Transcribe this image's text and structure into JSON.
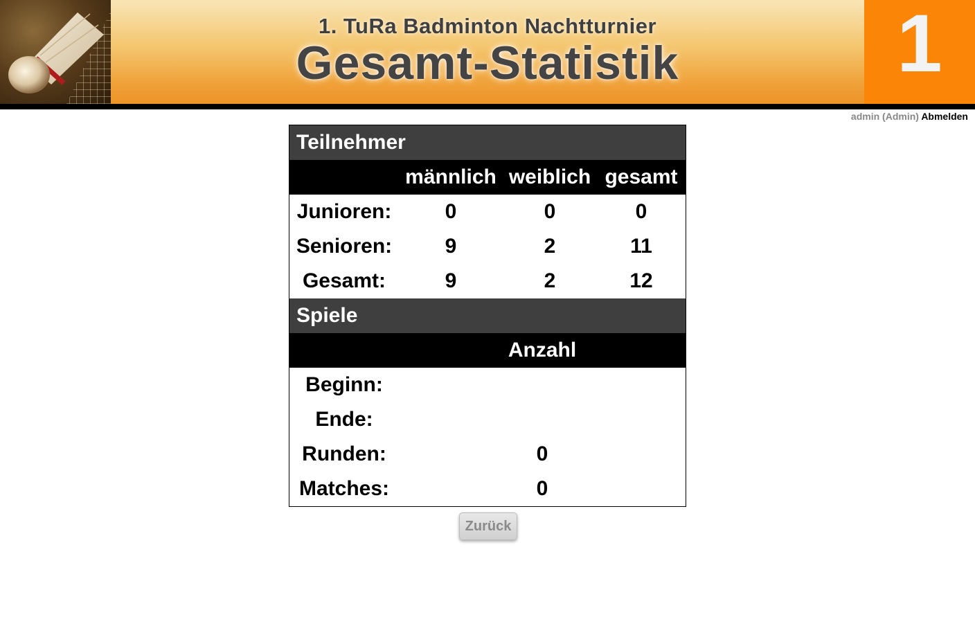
{
  "header": {
    "subtitle": "1. TuRa Badminton Nachtturnier",
    "title": "Gesamt-Statistik",
    "court_number": "1"
  },
  "user": {
    "name": "admin",
    "role": "(Admin)",
    "logout_label": "Abmelden"
  },
  "teilnehmer": {
    "section_title": "Teilnehmer",
    "columns": [
      "männlich",
      "weiblich",
      "gesamt"
    ],
    "rows": [
      {
        "label": "Junioren:",
        "male": "0",
        "female": "0",
        "total": "0"
      },
      {
        "label": "Senioren:",
        "male": "9",
        "female": "2",
        "total": "11"
      },
      {
        "label": "Gesamt:",
        "male": "9",
        "female": "2",
        "total": "12"
      }
    ]
  },
  "spiele": {
    "section_title": "Spiele",
    "column": "Anzahl",
    "rows": [
      {
        "label": "Beginn:",
        "value": ""
      },
      {
        "label": "Ende:",
        "value": ""
      },
      {
        "label": "Runden:",
        "value": "0"
      },
      {
        "label": "Matches:",
        "value": "0"
      }
    ]
  },
  "actions": {
    "back_label": "Zurück"
  },
  "colors": {
    "accent_orange": "#fb8506",
    "section_bg": "#3f3f3f",
    "column_header_bg": "#000000"
  }
}
